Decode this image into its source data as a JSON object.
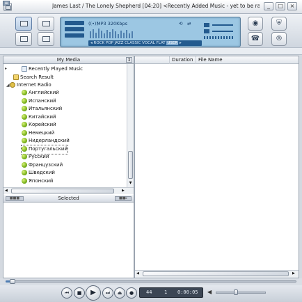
{
  "window": {
    "title": "James Last / The Lonely Shepherd [04:20] <Recently Added Music - yet to be rat...",
    "min_label": "_",
    "max_label": "□",
    "close_label": "×"
  },
  "lcd": {
    "bitrate": "MP3 320Kbps",
    "rec": "((•))",
    "eq_presets": [
      "ROCK",
      "POP",
      "JAZZ",
      "CLASSIC",
      "VOCAL",
      "FLAT"
    ],
    "eq_selected": "USER"
  },
  "strip": {
    "icon": "≡"
  },
  "my_media": {
    "header": "My Media",
    "items": [
      {
        "label": "Recently Played Music",
        "icon": "recent-icon",
        "level": 2
      },
      {
        "label": "Search Result",
        "icon": "search-folder-icon",
        "level": 1
      },
      {
        "label": "Internet Radio",
        "icon": "radio-folder-icon",
        "level": 1,
        "expanded": true
      },
      {
        "label": "Английский",
        "icon": "globe-icon",
        "level": 2
      },
      {
        "label": "Испанский",
        "icon": "globe-icon",
        "level": 2
      },
      {
        "label": "Итальянский",
        "icon": "globe-icon",
        "level": 2
      },
      {
        "label": "Китайский",
        "icon": "globe-icon",
        "level": 2
      },
      {
        "label": "Корейский",
        "icon": "globe-icon",
        "level": 2
      },
      {
        "label": "Немецкий",
        "icon": "globe-icon",
        "level": 2
      },
      {
        "label": "Нидерландский",
        "icon": "globe-icon",
        "level": 2
      },
      {
        "label": "Португальский",
        "icon": "globe-icon",
        "level": 2,
        "focused": true
      },
      {
        "label": "Русский",
        "icon": "globe-icon",
        "level": 2
      },
      {
        "label": "Французский",
        "icon": "globe-icon",
        "level": 2
      },
      {
        "label": "Шведский",
        "icon": "globe-icon",
        "level": 2
      },
      {
        "label": "Японский",
        "icon": "globe-icon",
        "level": 2
      }
    ]
  },
  "selected": {
    "header": "Selected"
  },
  "file_list": {
    "columns": [
      "Duration",
      "File Name"
    ]
  },
  "player": {
    "track_number": "44",
    "position": "1",
    "time": "0:00:05",
    "seek_fraction": 0.02,
    "volume_fraction": 0.4
  },
  "colors": {
    "accent": "#4e7db3",
    "lcd": "#9cc7e3"
  }
}
